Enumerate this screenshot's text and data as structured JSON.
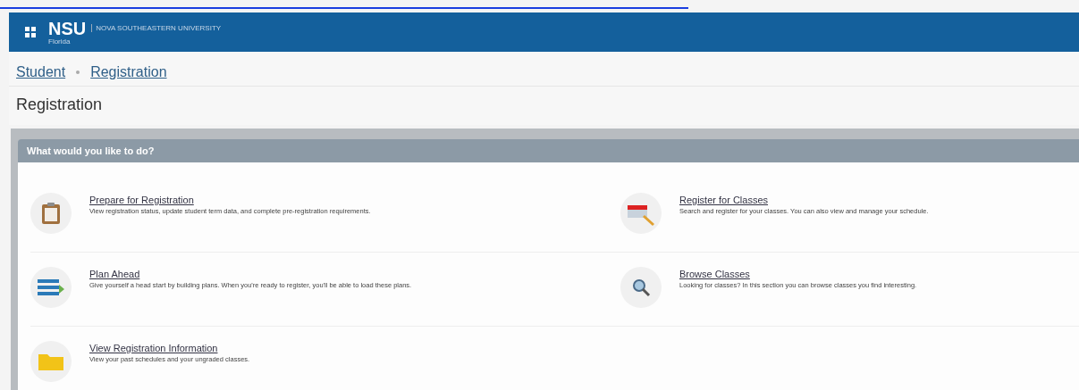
{
  "header": {
    "logo": "NSU",
    "university": "NOVA SOUTHEASTERN UNIVERSITY",
    "campus": "Florida"
  },
  "breadcrumb": [
    "Student",
    "Registration"
  ],
  "page_title": "Registration",
  "panel": {
    "title": "What would you like to do?",
    "items": [
      {
        "kind": "clipboard",
        "title": "Prepare for Registration",
        "description": "View registration status, update student term data, and complete pre-registration requirements."
      },
      {
        "kind": "calendar",
        "title": "Register for Classes",
        "description": "Search and register for your classes. You can also view and manage your schedule."
      },
      {
        "kind": "plan",
        "title": "Plan Ahead",
        "description": "Give yourself a head start by building plans. When you're ready to register, you'll be able to load these plans."
      },
      {
        "kind": "browse",
        "title": "Browse Classes",
        "description": "Looking for classes? In this section you can browse classes you find interesting."
      },
      {
        "kind": "folder",
        "title": "View Registration Information",
        "description": "View your past schedules and your ungraded classes."
      }
    ]
  }
}
